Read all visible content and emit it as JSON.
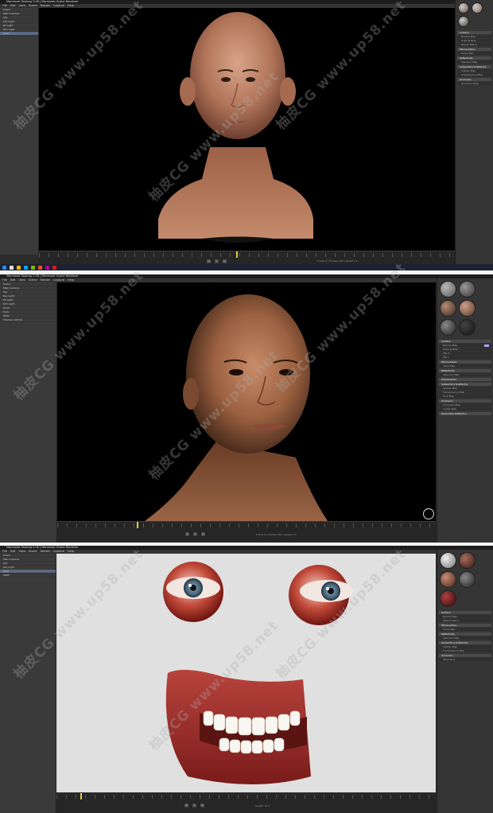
{
  "app": {
    "window_title": "Marmoset Toolbag 3.06 | Marmoset Scene Renderer"
  },
  "menu": [
    "File",
    "Edit",
    "View",
    "Scene",
    "Render",
    "Capture",
    "Help"
  ],
  "scene_tree": [
    "Scene",
    "Main Camera",
    "Sky",
    "Key Light",
    "Fill Light",
    "Rim Light",
    "Head",
    "Eyes",
    "Teeth",
    "Shadow Catcher"
  ],
  "materials_panel": {
    "section_headers": [
      "Surface",
      "Microsurface",
      "Reflectivity",
      "Transmission",
      "Subsurface Scattering",
      "Occlusion",
      "Secondary Reflection"
    ],
    "rows": [
      "Normal Map",
      "Scale & Bias",
      "Object Space",
      "Flip X",
      "Flip Y",
      "Albedo Map",
      "Color",
      "Gloss Map",
      "Specular Map",
      "Scatter Map",
      "Translucency Map",
      "Fuzz Map",
      "Occlusion Map",
      "Cavity Map",
      "Channel R"
    ],
    "mat_colors": [
      "#6b5040",
      "#8a6a58",
      "#4c4038",
      "#b58a72",
      "#242424",
      "#3a2b25",
      "#7a7a7a",
      "#1a1a1a"
    ]
  },
  "viewport_stats": {
    "line1": "Frame 0  |  Frames 300  |  Speed 1.0",
    "line2": "Length 10.0"
  },
  "watermark": "柚皮CG www.up58.net",
  "taskbar_colors": [
    "#2d89ef",
    "#e0e0e0",
    "#ffb900",
    "#00a4ef",
    "#7fba00",
    "#f25022",
    "#b4009e",
    "#e81123"
  ]
}
